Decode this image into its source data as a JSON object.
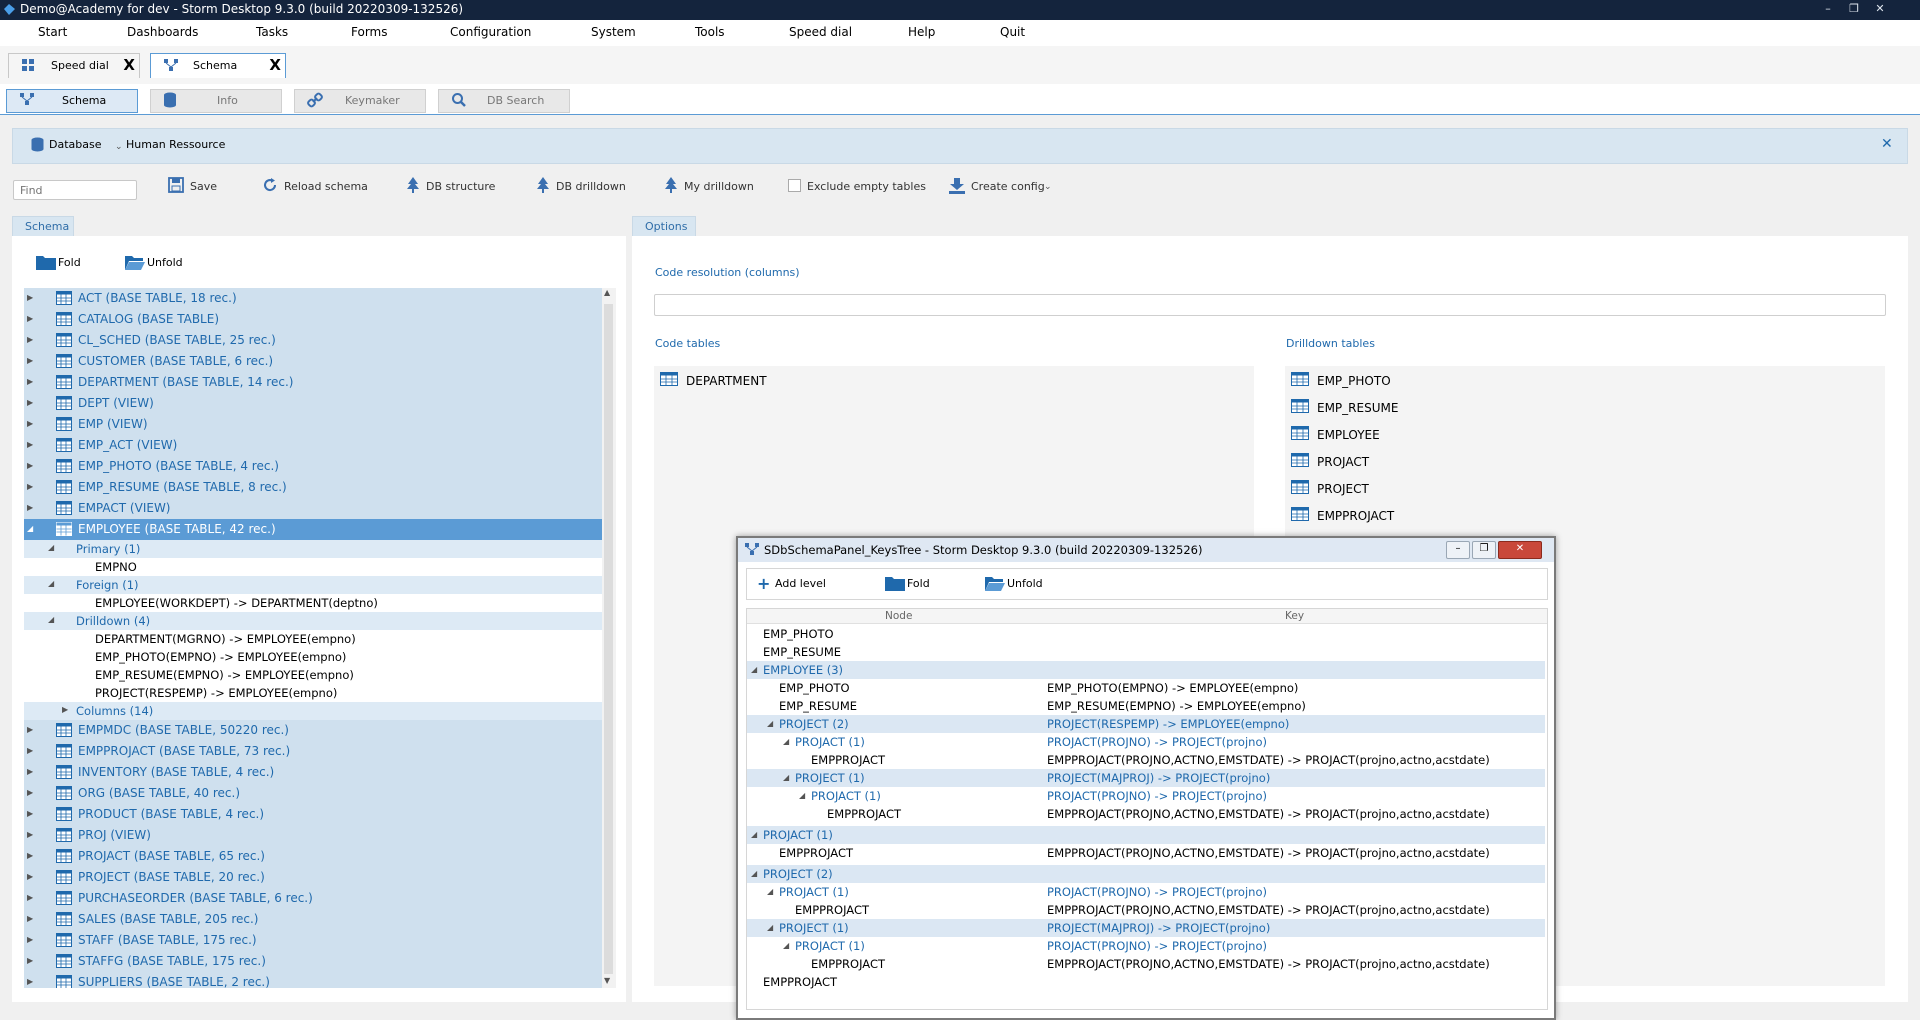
{
  "window": {
    "title": "Demo@Academy for dev - Storm Desktop 9.3.0 (build 20220309-132526)",
    "controls": [
      "–",
      "❐",
      "✕"
    ]
  },
  "menu": [
    "Start",
    "Dashboards",
    "Tasks",
    "Forms",
    "Configuration",
    "System",
    "Tools",
    "Speed dial",
    "Help",
    "Quit"
  ],
  "doc_tabs": [
    {
      "label": "Speed dial",
      "close": "X"
    },
    {
      "label": "Schema",
      "close": "X"
    }
  ],
  "sub_tabs": [
    "Schema",
    "Info",
    "Keymaker",
    "DB Search"
  ],
  "dbbar": {
    "database_label": "Database",
    "value": "Human Ressource",
    "close": "✕"
  },
  "toolbar": {
    "find_placeholder": "Find",
    "save": "Save",
    "reload": "Reload schema",
    "db_structure": "DB structure",
    "db_drilldown": "DB drilldown",
    "my_drilldown": "My drilldown",
    "exclude_empty": "Exclude empty tables",
    "create_config": "Create config"
  },
  "left_panel": {
    "tab": "Schema",
    "fold": "Fold",
    "unfold": "Unfold",
    "tables_top": [
      "ACT (BASE TABLE, 18 rec.)",
      "CATALOG (BASE TABLE)",
      "CL_SCHED (BASE TABLE, 25 rec.)",
      "CUSTOMER (BASE TABLE, 6 rec.)",
      "DEPARTMENT (BASE TABLE, 14 rec.)",
      "DEPT (VIEW)",
      "EMP (VIEW)",
      "EMP_ACT (VIEW)",
      "EMP_PHOTO (BASE TABLE, 4 rec.)",
      "EMP_RESUME (BASE TABLE, 8 rec.)",
      "EMPACT (VIEW)"
    ],
    "expanded_table": "EMPLOYEE (BASE TABLE, 42 rec.)",
    "primary_label": "Primary (1)",
    "primary_items": [
      "EMPNO"
    ],
    "foreign_label": "Foreign (1)",
    "foreign_items": [
      "EMPLOYEE(WORKDEPT) -> DEPARTMENT(deptno)"
    ],
    "drilldown_label": "Drilldown (4)",
    "drilldown_items": [
      "DEPARTMENT(MGRNO) -> EMPLOYEE(empno)",
      "EMP_PHOTO(EMPNO) -> EMPLOYEE(empno)",
      "EMP_RESUME(EMPNO) -> EMPLOYEE(empno)",
      "PROJECT(RESPEMP) -> EMPLOYEE(empno)"
    ],
    "columns_label": "Columns (14)",
    "tables_bottom": [
      "EMPMDC (BASE TABLE, 50220 rec.)",
      "EMPPROJACT (BASE TABLE, 73 rec.)",
      "INVENTORY (BASE TABLE, 4 rec.)",
      "ORG (BASE TABLE, 40 rec.)",
      "PRODUCT (BASE TABLE, 4 rec.)",
      "PROJ (VIEW)",
      "PROJACT (BASE TABLE, 65 rec.)",
      "PROJECT (BASE TABLE, 20 rec.)",
      "PURCHASEORDER (BASE TABLE, 6 rec.)",
      "SALES (BASE TABLE, 205 rec.)",
      "STAFF (BASE TABLE, 175 rec.)",
      "STAFFG (BASE TABLE, 175 rec.)",
      "SUPPLIERS (BASE TABLE, 2 rec.)"
    ]
  },
  "right_panel": {
    "tab": "Options",
    "code_resolution_label": "Code resolution (columns)",
    "code_tables_label": "Code tables",
    "code_tables": [
      "DEPARTMENT"
    ],
    "drilldown_tables_label": "Drilldown tables",
    "drilldown_tables": [
      "EMP_PHOTO",
      "EMP_RESUME",
      "EMPLOYEE",
      "PROJACT",
      "PROJECT",
      "EMPPROJACT"
    ]
  },
  "keys_window": {
    "title": "SDbSchemaPanel_KeysTree -  Storm Desktop 9.3.0 (build 20220309-132526)",
    "add_level": "Add level",
    "fold": "Fold",
    "unfold": "Unfold",
    "col_node": "Node",
    "col_key": "Key",
    "rows": [
      {
        "node": "EMP_PHOTO",
        "key": ""
      },
      {
        "node": "EMP_RESUME",
        "key": ""
      },
      {
        "node": "EMPLOYEE (3)",
        "key": ""
      },
      {
        "node": "EMP_PHOTO",
        "key": "EMP_PHOTO(EMPNO) -> EMPLOYEE(empno)"
      },
      {
        "node": "EMP_RESUME",
        "key": "EMP_RESUME(EMPNO) -> EMPLOYEE(empno)"
      },
      {
        "node": "PROJECT (2)",
        "key": "PROJECT(RESPEMP) -> EMPLOYEE(empno)"
      },
      {
        "node": "PROJACT (1)",
        "key": "PROJACT(PROJNO) -> PROJECT(projno)"
      },
      {
        "node": "EMPPROJACT",
        "key": "EMPPROJACT(PROJNO,ACTNO,EMSTDATE) -> PROJACT(projno,actno,acstdate)"
      },
      {
        "node": "PROJECT (1)",
        "key": "PROJECT(MAJPROJ) -> PROJECT(projno)"
      },
      {
        "node": "PROJACT (1)",
        "key": "PROJACT(PROJNO) -> PROJECT(projno)"
      },
      {
        "node": "EMPPROJACT",
        "key": "EMPPROJACT(PROJNO,ACTNO,EMSTDATE) -> PROJACT(projno,actno,acstdate)"
      },
      {
        "node": "PROJACT (1)",
        "key": ""
      },
      {
        "node": "EMPPROJACT",
        "key": "EMPPROJACT(PROJNO,ACTNO,EMSTDATE) -> PROJACT(projno,actno,acstdate)"
      },
      {
        "node": "PROJECT (2)",
        "key": ""
      },
      {
        "node": "PROJACT (1)",
        "key": "PROJACT(PROJNO) -> PROJECT(projno)"
      },
      {
        "node": "EMPPROJACT",
        "key": "EMPPROJACT(PROJNO,ACTNO,EMSTDATE) -> PROJACT(projno,actno,acstdate)"
      },
      {
        "node": "PROJECT (1)",
        "key": "PROJECT(MAJPROJ) -> PROJECT(projno)"
      },
      {
        "node": "PROJACT (1)",
        "key": "PROJACT(PROJNO) -> PROJECT(projno)"
      },
      {
        "node": "EMPPROJACT",
        "key": "EMPPROJACT(PROJNO,ACTNO,EMSTDATE) -> PROJACT(projno,actno,acstdate)"
      },
      {
        "node": "EMPPROJACT",
        "key": ""
      }
    ]
  },
  "colors": {
    "accent": "#5b9bd5",
    "link": "#1f69ac",
    "band": "#cfe0ee",
    "titlebar": "#14243d"
  }
}
